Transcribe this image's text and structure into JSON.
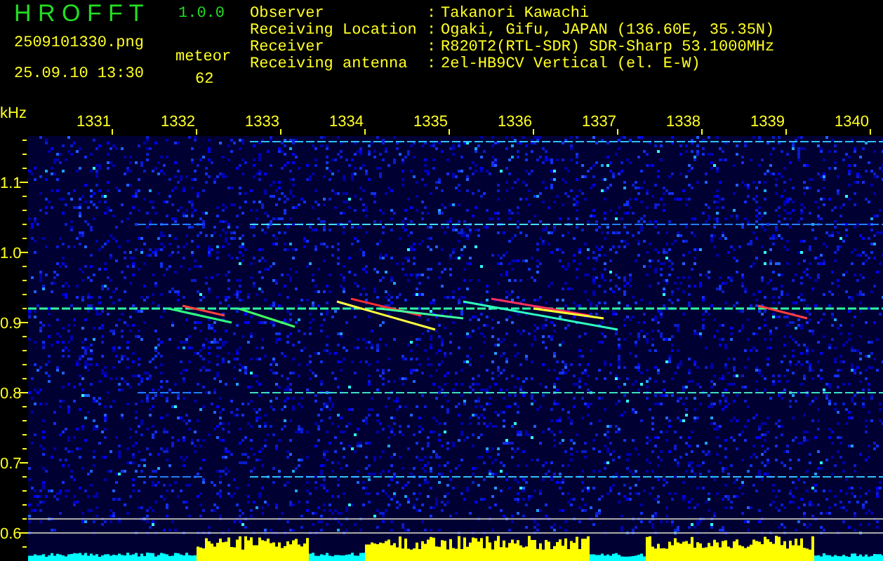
{
  "app": {
    "title": "H R O F F T",
    "version": "1.0.0",
    "filename": "2509101330.png",
    "timestamp": "25.09.10 13:30",
    "count_label": "meteor",
    "count": "62"
  },
  "info": [
    {
      "label": "Observer",
      "colon": ":",
      "value": "Takanori Kawachi"
    },
    {
      "label": "Receiving Location",
      "colon": ":",
      "value": "Ogaki, Gifu, JAPAN (136.60E, 35.35N)"
    },
    {
      "label": "Receiver",
      "colon": ":",
      "value": "R820T2(RTL-SDR) SDR-Sharp 53.1000MHz"
    },
    {
      "label": "Receiving antenna",
      "colon": ":",
      "value": "2el-HB9CV Vertical (el. E-W)"
    }
  ],
  "spectrogram": {
    "y_unit": "kHz",
    "x_ticks": [
      "1331",
      "1332",
      "1333",
      "1334",
      "1335",
      "1336",
      "1337",
      "1338",
      "1339",
      "1340"
    ],
    "y_ticks": [
      "1.1",
      "1.0",
      "0.9",
      "0.8",
      "0.7",
      "0.6"
    ]
  }
}
